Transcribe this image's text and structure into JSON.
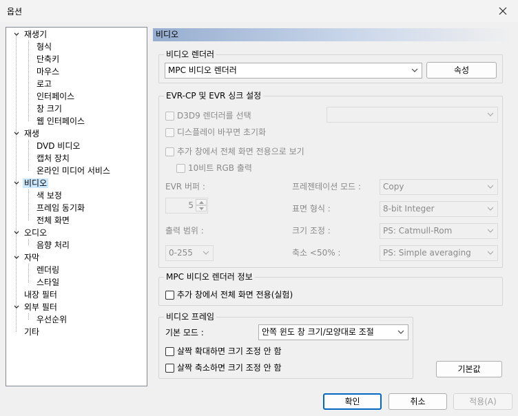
{
  "window": {
    "title": "옵션"
  },
  "tree": {
    "items": [
      {
        "label": "재생기"
      },
      {
        "label": "형식"
      },
      {
        "label": "단축키"
      },
      {
        "label": "마우스"
      },
      {
        "label": "로고"
      },
      {
        "label": "인터페이스"
      },
      {
        "label": "창 크기"
      },
      {
        "label": "웹 인터페이스"
      },
      {
        "label": "재생"
      },
      {
        "label": "DVD 비디오"
      },
      {
        "label": "캡처 장치"
      },
      {
        "label": "온라인 미디어 서비스"
      },
      {
        "label": "비디오"
      },
      {
        "label": "색 보정"
      },
      {
        "label": "프레임 동기화"
      },
      {
        "label": "전체 화면"
      },
      {
        "label": "오디오"
      },
      {
        "label": "음향 처리"
      },
      {
        "label": "자막"
      },
      {
        "label": "렌더링"
      },
      {
        "label": "스타일"
      },
      {
        "label": "내장 필터"
      },
      {
        "label": "외부 필터"
      },
      {
        "label": "우선순위"
      },
      {
        "label": "기타"
      }
    ]
  },
  "panel": {
    "header": "비디오",
    "renderer_group": {
      "title": "비디오 렌더러",
      "renderer_value": "MPC 비디오 렌더러",
      "properties_button": "속성"
    },
    "evr_group": {
      "title": "EVR-CP 및 EVR 싱크 설정",
      "d3d9_label": "D3D9 렌더러를 선택",
      "reset_display_label": "디스플레이 바꾸면 초기화",
      "exclusive_label": "추가 창에서 전체 화면 전용으로 보기",
      "tenbit_label": "10비트 RGB 출력",
      "evr_buffer_label": "EVR 버퍼 :",
      "evr_buffer_value": "5",
      "present_mode_label": "프레젠테이션 모드 :",
      "present_mode_value": "Copy",
      "surface_format_label": "표면 형식 :",
      "surface_format_value": "8-bit Integer",
      "output_range_label": "출력 범위 :",
      "output_range_value": "0-255",
      "resize_label": "크기 조정 :",
      "resize_value": "PS: Catmull-Rom",
      "downscale_label": "축소 <50% :",
      "downscale_value": "PS: Simple averaging"
    },
    "mpcvr_group": {
      "title": "MPC 비디오 렌더러 정보",
      "exclusive_label": "추가 창에서 전체 화면 전용(실험)"
    },
    "frame_group": {
      "title": "비디오 프레임",
      "default_mode_label": "기본 모드 :",
      "default_mode_value": "안쪽 윈도 창 크기/모양대로 조절",
      "no_zoom_in_label": "살짝 확대하면 크기 조정 안 함",
      "no_zoom_out_label": "살짝 축소하면 크기 조정 안 함"
    },
    "default_button": "기본값"
  },
  "footer": {
    "ok": "확인",
    "cancel": "취소",
    "apply": "적용(A)"
  }
}
